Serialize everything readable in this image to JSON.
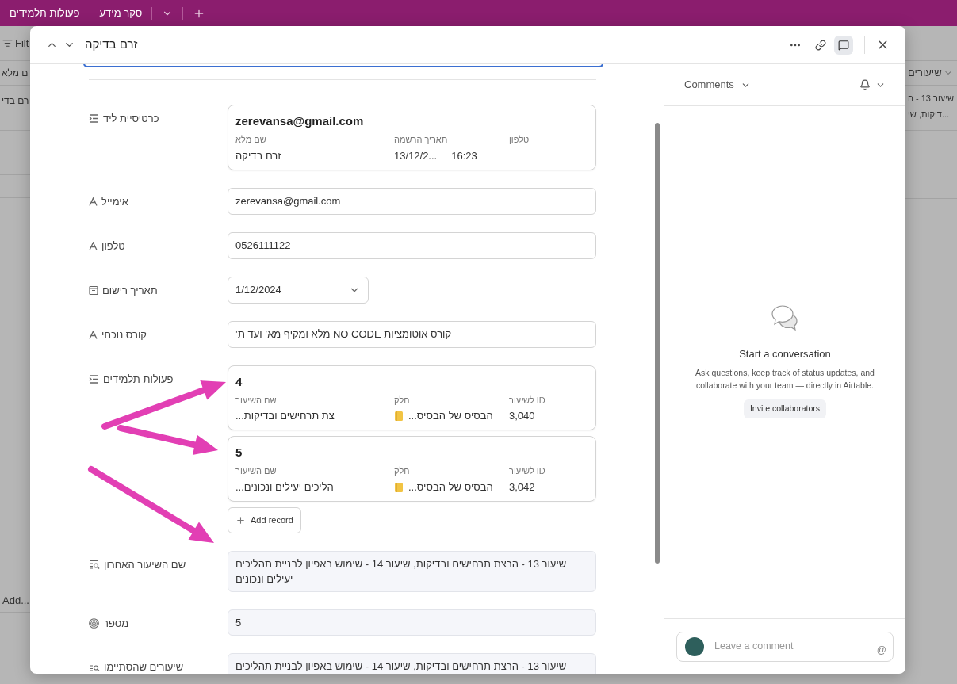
{
  "app_bar": {
    "tabs": [
      {
        "label": "סקר מידע"
      },
      {
        "label": "פעולות תלמידים"
      }
    ]
  },
  "background": {
    "filter_label": "Filt",
    "left_column": "ם מלא",
    "left_cell": "רם בדי",
    "right_column": "שיעורים",
    "right_cell": [
      "שיעור 13 - ה",
      "...דיקות, שי"
    ],
    "add_label": "Add..."
  },
  "record": {
    "title": "זרם בדיקה",
    "comments_toggle_selected": true,
    "fields": [
      {
        "kind": "linked",
        "label": "כרטיסיית ליד",
        "records": [
          {
            "title": "zerevansa@gmail.com",
            "columns": [
              {
                "kind": "text",
                "label": "טלפון"
              },
              {
                "kind": "datetime",
                "label": "תאריך הרשמה",
                "value": "13/12/2...",
                "time": "16:23"
              },
              {
                "kind": "text",
                "label": "שם מלא",
                "value": "זרם בדיקה"
              }
            ]
          }
        ]
      },
      {
        "kind": "text",
        "label": "אימייל",
        "value": "zerevansa@gmail.com"
      },
      {
        "kind": "text",
        "label": "טלפון",
        "value": "0526111122"
      },
      {
        "kind": "date",
        "label": "תאריך רישום",
        "value": "1/12/2024"
      },
      {
        "kind": "text",
        "label": "קורס נוכחי",
        "value": "קורס אוטומציות NO CODE מלא ומקיף מא’ ועד ת’"
      },
      {
        "kind": "linked",
        "label": "פעולות תלמידים",
        "add_label": "Add record",
        "records": [
          {
            "title": "4",
            "columns": [
              {
                "kind": "text",
                "label": "ID לשיעור",
                "value": "3,040"
              },
              {
                "kind": "link",
                "label": "חלק",
                "value": "...הבסיס של הבסיס"
              },
              {
                "kind": "text",
                "label": "שם השיעור",
                "value": "...צת תרחישים ובדיקות"
              }
            ]
          },
          {
            "title": "5",
            "columns": [
              {
                "kind": "text",
                "label": "ID לשיעור",
                "value": "3,042"
              },
              {
                "kind": "link",
                "label": "חלק",
                "value": "...הבסיס של הבסיס"
              },
              {
                "kind": "text",
                "label": "שם השיעור",
                "value": "...הליכים יעילים ונכונים"
              }
            ]
          }
        ]
      },
      {
        "kind": "lookup",
        "label": "שם השיעור האחרון",
        "value": "שיעור 13 - הרצת תרחישים ובדיקות, שיעור 14 - שימוש באפיון לבניית תהליכים יעילים ונכונים"
      },
      {
        "kind": "count",
        "label": "מספר",
        "value": "5"
      },
      {
        "kind": "lookup",
        "label": "שיעורים שהסתיימו",
        "value": "שיעור 13 - הרצת תרחישים ובדיקות, שיעור 14 - שימוש באפיון לבניית תהליכים"
      }
    ]
  },
  "comments": {
    "title": "Comments",
    "empty_title": "Start a conversation",
    "empty_text": "Ask questions, keep track of status updates, and collaborate with your team — directly in Airtable.",
    "invite_label": "Invite collaborators",
    "placeholder": "Leave a comment",
    "mention": "@"
  }
}
